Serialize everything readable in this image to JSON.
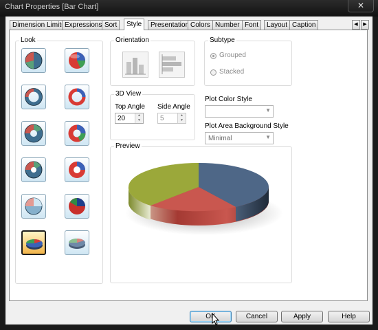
{
  "window": {
    "title": "Chart Properties [Bar Chart]",
    "close_glyph": "✕"
  },
  "tabs": [
    {
      "label": "Dimension Limits",
      "active": false
    },
    {
      "label": "Expressions",
      "active": false
    },
    {
      "label": "Sort",
      "active": false
    },
    {
      "label": "Style",
      "active": true
    },
    {
      "label": "Presentation",
      "active": false
    },
    {
      "label": "Colors",
      "active": false
    },
    {
      "label": "Number",
      "active": false
    },
    {
      "label": "Font",
      "active": false
    },
    {
      "label": "Layout",
      "active": false
    },
    {
      "label": "Caption",
      "active": false
    }
  ],
  "tab_scroll": {
    "left": "◀",
    "right": "▶"
  },
  "look": {
    "label": "Look",
    "styles": [
      {
        "icon": "pie-3slice-flat-icon",
        "selected": false
      },
      {
        "icon": "pie-glossy-3d-icon",
        "selected": false
      },
      {
        "icon": "donut-flat-icon",
        "selected": false
      },
      {
        "icon": "donut-glossy-icon",
        "selected": false
      },
      {
        "icon": "donut-thick-flat-icon",
        "selected": false
      },
      {
        "icon": "donut-thick-glossy-icon",
        "selected": false
      },
      {
        "icon": "pie-ring-flat-icon",
        "selected": false
      },
      {
        "icon": "pie-ring-glossy-icon",
        "selected": false
      },
      {
        "icon": "pie-light-flat-icon",
        "selected": false
      },
      {
        "icon": "pie-dark-glossy-icon",
        "selected": false
      },
      {
        "icon": "pie-3d-tilted-icon",
        "selected": true
      },
      {
        "icon": "pie-3d-tilted-light-icon",
        "selected": false
      }
    ]
  },
  "orientation": {
    "label": "Orientation",
    "options": [
      {
        "icon": "vertical-bars-icon"
      },
      {
        "icon": "horizontal-bars-icon"
      }
    ]
  },
  "subtype": {
    "label": "Subtype",
    "grouped": {
      "label": "Grouped",
      "checked": true
    },
    "stacked": {
      "label": "Stacked",
      "checked": false
    }
  },
  "view3d": {
    "label": "3D View",
    "top_angle": {
      "label": "Top Angle",
      "value": "20"
    },
    "side_angle": {
      "label": "Side Angle",
      "value": "5"
    }
  },
  "plot_color_style": {
    "label": "Plot Color Style",
    "value": ""
  },
  "plot_area_bg_style": {
    "label": "Plot Area Background Style",
    "value": "Minimal"
  },
  "preview": {
    "label": "Preview"
  },
  "buttons": {
    "ok": "OK",
    "cancel": "Cancel",
    "apply": "Apply",
    "help": "Help"
  },
  "colors": {
    "slice_olive": "#9ba83a",
    "slice_slate": "#4e6787",
    "slice_red": "#c9574f",
    "accent_selected": "#f2b54a"
  }
}
